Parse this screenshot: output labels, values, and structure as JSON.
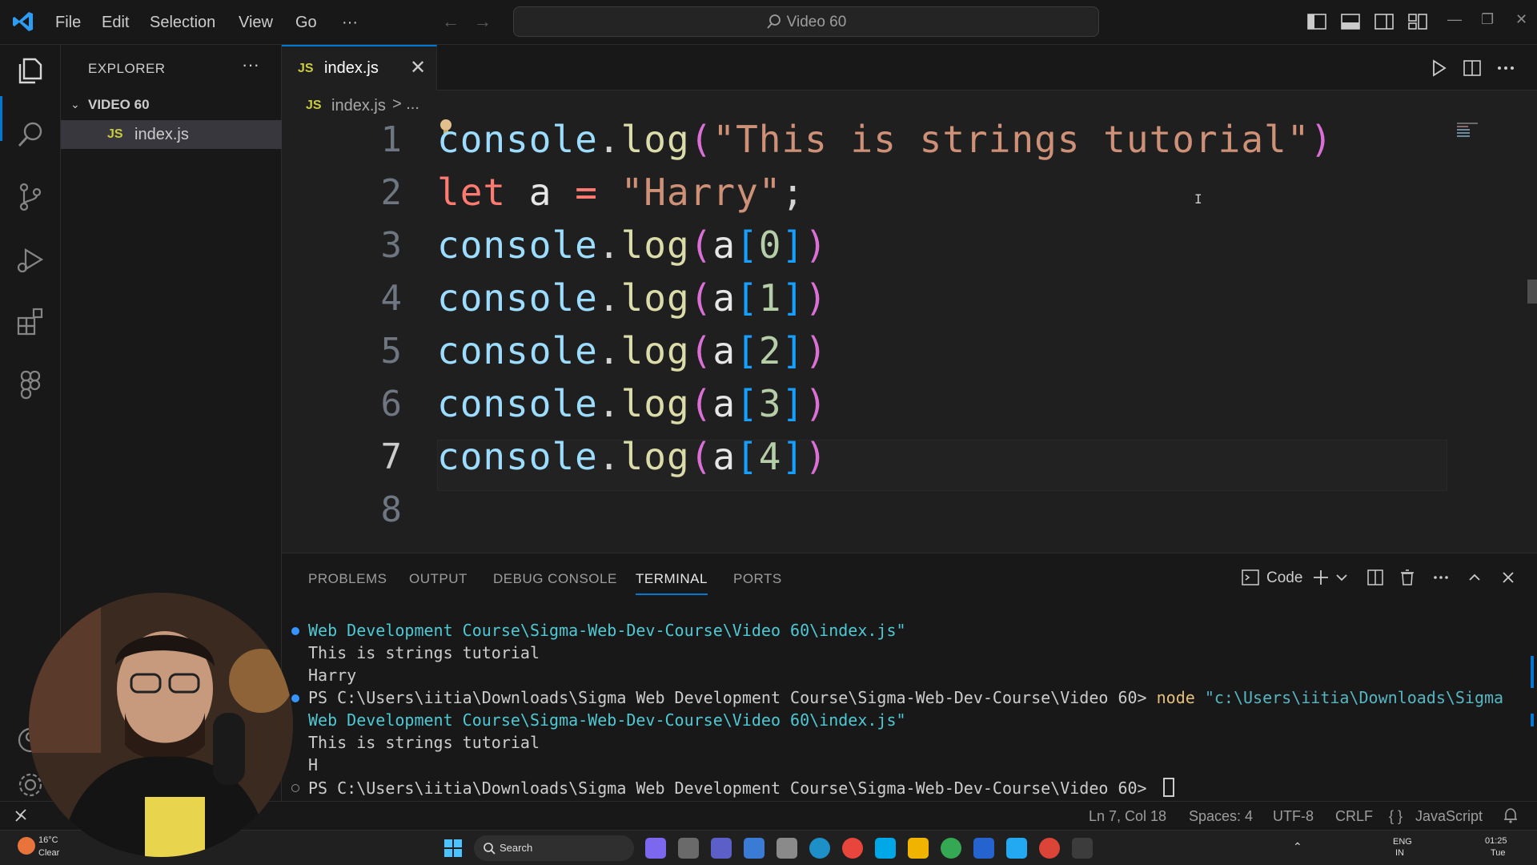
{
  "titlebar": {
    "menu": [
      "File",
      "Edit",
      "Selection",
      "View",
      "Go",
      "···"
    ],
    "search_text": "Video 60"
  },
  "sidebar": {
    "title": "EXPLORER",
    "more": "···",
    "folder": "VIDEO 60",
    "files": [
      {
        "badge": "JS",
        "name": "index.js"
      }
    ]
  },
  "editor": {
    "tab": {
      "badge": "JS",
      "label": "index.js",
      "close": "✕"
    },
    "breadcrumb": {
      "badge": "JS",
      "file": "index.js",
      "sep": "> ..."
    },
    "line_numbers": [
      "1",
      "2",
      "3",
      "4",
      "5",
      "6",
      "7",
      "8"
    ],
    "lines": [
      {
        "parts": [
          [
            "tok-fn-obj",
            "console"
          ],
          [
            "tok-punc",
            "."
          ],
          [
            "tok-fn",
            "log"
          ],
          [
            "tok-paren",
            "("
          ],
          [
            "tok-str",
            "\"This is strings tutorial\""
          ],
          [
            "tok-paren",
            ")"
          ]
        ]
      },
      {
        "parts": [
          [
            "tok-kw",
            "let"
          ],
          [
            "tok-var",
            " a "
          ],
          [
            "tok-kw",
            "="
          ],
          [
            "tok-var",
            " "
          ],
          [
            "tok-str",
            "\"Harry\""
          ],
          [
            "tok-punc",
            ";"
          ]
        ]
      },
      {
        "parts": [
          [
            "tok-fn-obj",
            "console"
          ],
          [
            "tok-punc",
            "."
          ],
          [
            "tok-fn",
            "log"
          ],
          [
            "tok-paren",
            "("
          ],
          [
            "tok-var",
            "a"
          ],
          [
            "tok-br",
            "["
          ],
          [
            "tok-num",
            "0"
          ],
          [
            "tok-br",
            "]"
          ],
          [
            "tok-paren",
            ")"
          ]
        ]
      },
      {
        "parts": [
          [
            "tok-fn-obj",
            "console"
          ],
          [
            "tok-punc",
            "."
          ],
          [
            "tok-fn",
            "log"
          ],
          [
            "tok-paren",
            "("
          ],
          [
            "tok-var",
            "a"
          ],
          [
            "tok-br",
            "["
          ],
          [
            "tok-num",
            "1"
          ],
          [
            "tok-br",
            "]"
          ],
          [
            "tok-paren",
            ")"
          ]
        ]
      },
      {
        "parts": [
          [
            "tok-fn-obj",
            "console"
          ],
          [
            "tok-punc",
            "."
          ],
          [
            "tok-fn",
            "log"
          ],
          [
            "tok-paren",
            "("
          ],
          [
            "tok-var",
            "a"
          ],
          [
            "tok-br",
            "["
          ],
          [
            "tok-num",
            "2"
          ],
          [
            "tok-br",
            "]"
          ],
          [
            "tok-paren",
            ")"
          ]
        ]
      },
      {
        "parts": [
          [
            "tok-fn-obj",
            "console"
          ],
          [
            "tok-punc",
            "."
          ],
          [
            "tok-fn",
            "log"
          ],
          [
            "tok-paren",
            "("
          ],
          [
            "tok-var",
            "a"
          ],
          [
            "tok-br",
            "["
          ],
          [
            "tok-num",
            "3"
          ],
          [
            "tok-br",
            "]"
          ],
          [
            "tok-paren",
            ")"
          ]
        ]
      },
      {
        "parts": [
          [
            "tok-fn-obj",
            "console"
          ],
          [
            "tok-punc",
            "."
          ],
          [
            "tok-fn",
            "log"
          ],
          [
            "tok-paren",
            "("
          ],
          [
            "tok-var",
            "a"
          ],
          [
            "tok-br",
            "["
          ],
          [
            "tok-num",
            "4"
          ],
          [
            "tok-br",
            "]"
          ],
          [
            "tok-paren",
            ")"
          ]
        ]
      },
      {
        "parts": []
      }
    ]
  },
  "panel": {
    "tabs": [
      "PROBLEMS",
      "OUTPUT",
      "DEBUG CONSOLE",
      "TERMINAL",
      "PORTS"
    ],
    "active_tab": "TERMINAL",
    "terminal_name": "Code",
    "terminal_lines": [
      {
        "dot": "blue",
        "parts": [
          [
            "t-cyan",
            "Web Development Course\\Sigma-Web-Dev-Course\\Video 60\\index.js\""
          ]
        ]
      },
      {
        "dot": "",
        "parts": [
          [
            "",
            "This is strings tutorial"
          ]
        ]
      },
      {
        "dot": "",
        "parts": [
          [
            "",
            "Harry"
          ]
        ]
      },
      {
        "dot": "blue",
        "parts": [
          [
            "",
            "PS C:\\Users\\iitia\\Downloads\\Sigma Web Development Course\\Sigma-Web-Dev-Course\\Video 60> "
          ],
          [
            "t-yellow",
            "node "
          ],
          [
            "t-cyan2",
            "\"c:\\Users\\iitia\\Downloads\\Sigma"
          ]
        ]
      },
      {
        "dot": "",
        "parts": [
          [
            "t-cyan",
            "Web Development Course\\Sigma-Web-Dev-Course\\Video 60\\index.js\""
          ]
        ]
      },
      {
        "dot": "",
        "parts": [
          [
            "",
            "This is strings tutorial"
          ]
        ]
      },
      {
        "dot": "",
        "parts": [
          [
            "",
            "H"
          ]
        ]
      },
      {
        "dot": "grey",
        "parts": [
          [
            "",
            "PS C:\\Users\\iitia\\Downloads\\Sigma Web Development Course\\Sigma-Web-Dev-Course\\Video 60> "
          ]
        ]
      }
    ]
  },
  "statusbar": {
    "position": "Ln 7, Col 18",
    "spaces": "Spaces: 4",
    "encoding": "UTF-8",
    "eol": "CRLF",
    "language_prefix": "{ }",
    "language": "JavaScript"
  },
  "taskbar": {
    "weather_temp": "16°C",
    "weather_desc": "Clear",
    "search_label": "Search",
    "lang_top": "ENG",
    "lang_bottom": "IN",
    "time": "01:25",
    "day": "Tue"
  },
  "colors": {
    "accent": "#0078d4",
    "js_badge": "#cbcb41"
  }
}
